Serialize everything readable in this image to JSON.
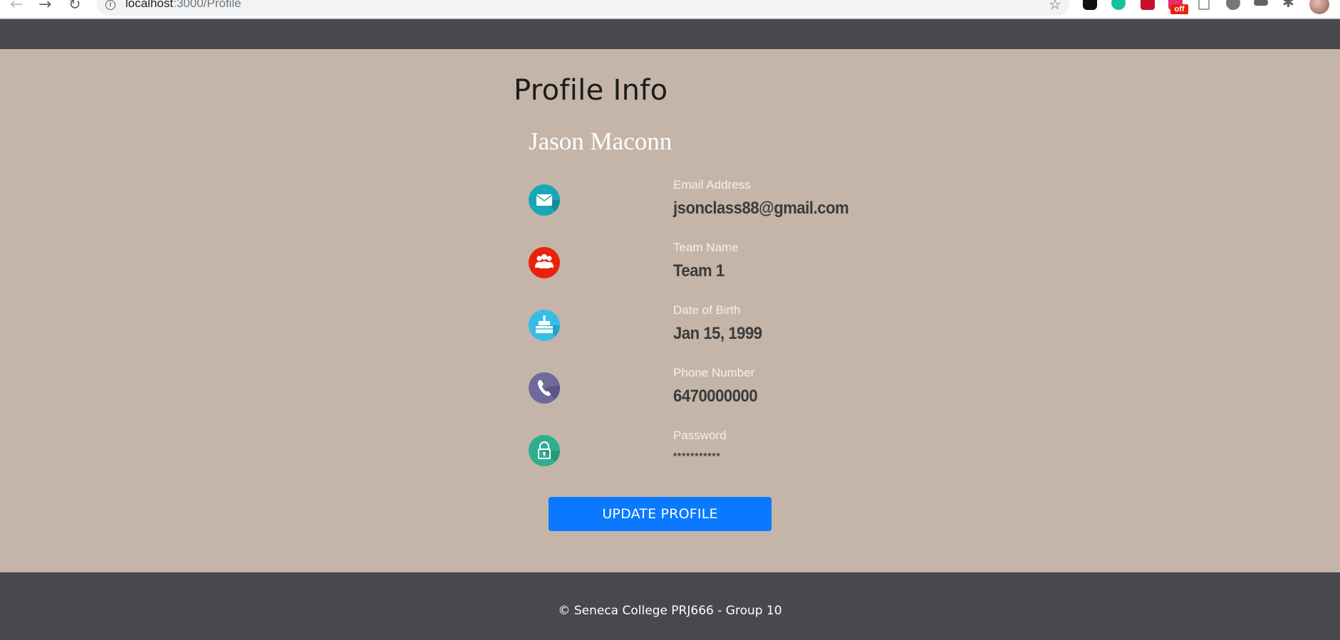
{
  "browser": {
    "url_host": "localhost",
    "url_rest": ":3000/Profile",
    "icons": [
      "back-icon",
      "forward-icon",
      "reload-icon",
      "info-icon",
      "star-icon",
      "extensions-icon"
    ],
    "badge_text": "off"
  },
  "profile": {
    "title": "Profile Info",
    "name": "Jason Maconn",
    "fields": [
      {
        "icon": "email-icon",
        "label": "Email Address",
        "value": "jsonclass88@gmail.com",
        "color": "#1aa8b8"
      },
      {
        "icon": "team-icon",
        "label": "Team Name",
        "value": "Team 1",
        "color": "#e8230d"
      },
      {
        "icon": "birthday-cake-icon",
        "label": "Date of Birth",
        "value": "Jan 15, 1999",
        "color": "#35bde6"
      },
      {
        "icon": "phone-icon",
        "label": "Phone Number",
        "value": "6470000000",
        "color": "#6e6a9c"
      },
      {
        "icon": "lock-icon",
        "label": "Password",
        "value": "***********",
        "color": "#2fae8f"
      }
    ],
    "update_button": "UPDATE PROFILE"
  },
  "footer": {
    "text": "© Seneca College PRJ666 - Group 10"
  },
  "colors": {
    "page_background": "#c4b5a8",
    "header_footer": "#48484d",
    "button": "#0a79ff"
  }
}
